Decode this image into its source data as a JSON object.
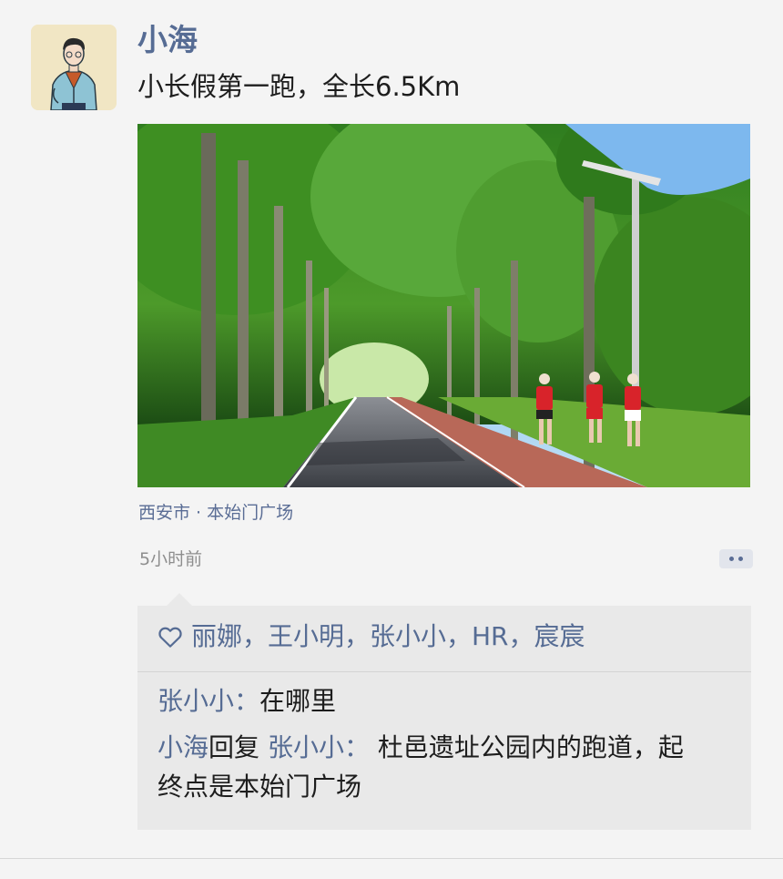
{
  "post": {
    "author": "小海",
    "text": "小长假第一跑，全长6.5Km",
    "location": "西安市 · 本始门广场",
    "time": "5小时前"
  },
  "likes": {
    "names": "丽娜，王小明，张小小，HR，宸宸"
  },
  "comments": [
    {
      "author": "张小小",
      "separator": "：",
      "text": "在哪里"
    },
    {
      "author": "小海",
      "reply_word": "回复",
      "reply_to": "张小小",
      "separator": "：",
      "text_line1": "杜邑遗址公园内的跑道，起",
      "text_line2": "终点是本始门广场"
    }
  ],
  "colors": {
    "name_blue": "#566c94",
    "background": "#f4f4f4",
    "comment_box": "#e9e9e9"
  },
  "icons": [
    "avatar",
    "heart-icon",
    "more-icon"
  ]
}
